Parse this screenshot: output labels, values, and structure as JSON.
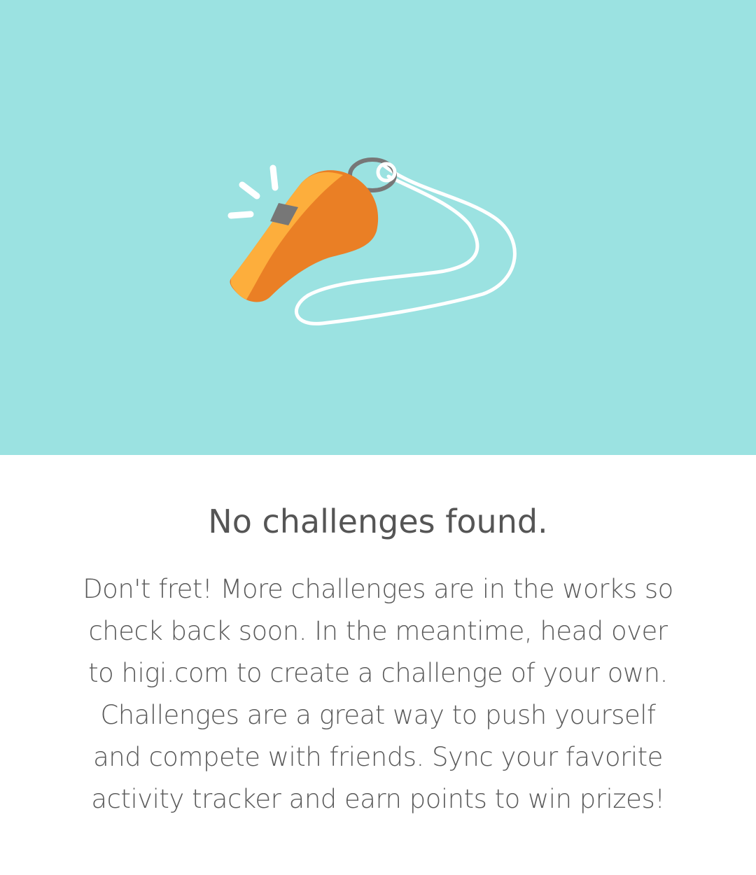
{
  "hero": {
    "illustration": "whistle-icon",
    "background_color": "#9be2e1",
    "whistle_colors": {
      "body": "#ea7f25",
      "highlight": "#fdae3c",
      "ring": "#777777",
      "lanyard": "#ffffff"
    }
  },
  "empty_state": {
    "title": "No challenges found.",
    "message_lines": [
      "Don't fret! More challenges are in the works so",
      "check back soon. In the meantime, head over",
      "to higi.com to create a challenge of your own.",
      "Challenges are a great way to push yourself",
      "and compete with friends. Sync your favorite",
      "activity tracker and earn points to win prizes!"
    ]
  }
}
